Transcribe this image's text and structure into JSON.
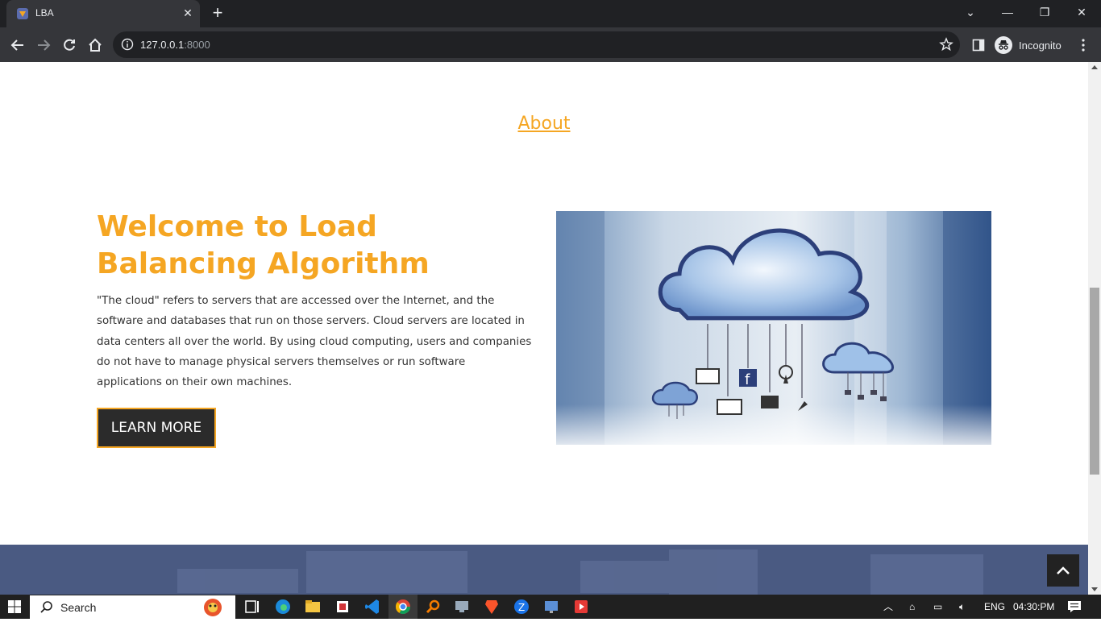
{
  "browser": {
    "tab_title": "LBA",
    "url_host": "127.0.0.1",
    "url_port": ":8000",
    "profile_label": "Incognito"
  },
  "page": {
    "about_link": "About",
    "heading": "Welcome to Load Balancing Algorithm",
    "description": "\"The cloud\" refers to servers that are accessed over the Internet, and the software and databases that run on those servers. Cloud servers are located in data centers all over the world. By using cloud computing, users and companies do not have to manage physical servers themselves or run software applications on their own machines.",
    "learn_more": "LEARN MORE"
  },
  "taskbar": {
    "search_label": "Search",
    "language": "ENG",
    "time": "04:30:PM"
  },
  "colors": {
    "accent": "#f5a623",
    "footer": "#4a5a82"
  }
}
